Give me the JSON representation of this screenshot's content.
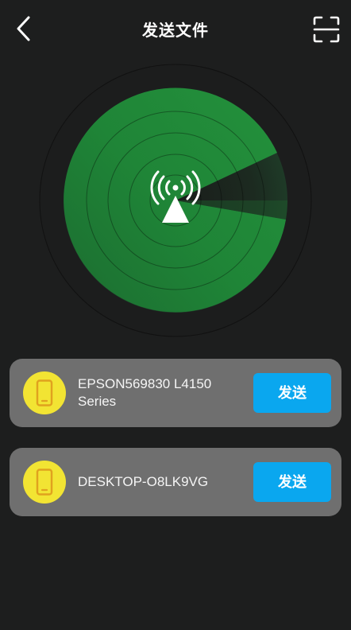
{
  "header": {
    "title": "发送文件",
    "back_icon": "chevron-left-icon",
    "scan_icon": "scan-frame-icon"
  },
  "radar": {
    "center_icon": "wireless-signal-icon",
    "colors": {
      "sweep": "#1f8a38",
      "rings": "#000000",
      "marker": "#ffffff"
    }
  },
  "devices": [
    {
      "name": "EPSON569830 L4150 Series",
      "icon": "phone-icon",
      "send_label": "发送"
    },
    {
      "name": "DESKTOP-O8LK9VG",
      "icon": "phone-icon",
      "send_label": "发送"
    }
  ],
  "colors": {
    "background": "#1d1e1e",
    "card": "#6f6f6f",
    "avatar": "#f2e433",
    "button": "#0aa7ef"
  }
}
